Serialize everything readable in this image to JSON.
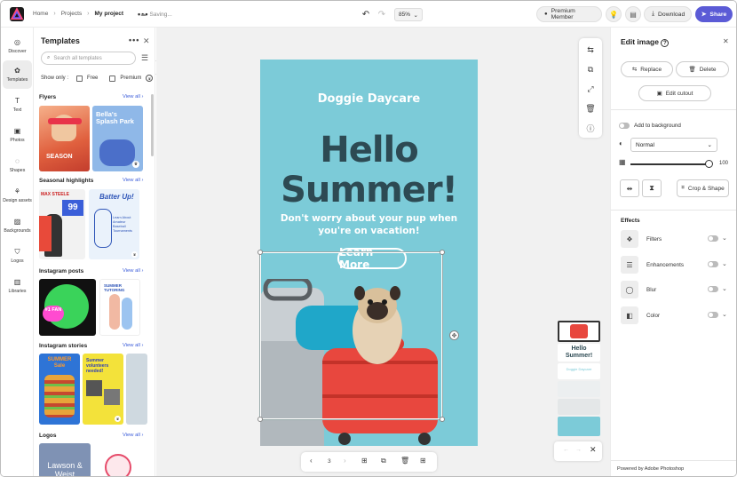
{
  "header": {
    "breadcrumbs": [
      "Home",
      "Projects",
      "My project"
    ],
    "status": "Saving...",
    "zoom": "85%",
    "premium_label": "Premium Member",
    "download_label": "Download",
    "share_label": "Share"
  },
  "rail": {
    "items": [
      {
        "label": "Discover",
        "icon": "compass-icon"
      },
      {
        "label": "Templates",
        "icon": "templates-icon"
      },
      {
        "label": "Text",
        "icon": "text-icon"
      },
      {
        "label": "Photos",
        "icon": "photo-icon"
      },
      {
        "label": "Shapes",
        "icon": "shapes-icon"
      },
      {
        "label": "Design assets",
        "icon": "design-assets-icon"
      },
      {
        "label": "Backgrounds",
        "icon": "backgrounds-icon"
      },
      {
        "label": "Logos",
        "icon": "logo-icon"
      },
      {
        "label": "Libraries",
        "icon": "library-icon"
      }
    ]
  },
  "templates": {
    "title": "Templates",
    "search_placeholder": "Search all templates",
    "show_only": "Show only :",
    "filters": [
      "Free",
      "Premium"
    ],
    "view_all": "View all",
    "sections": [
      "Flyers",
      "Seasonal highlights",
      "Instagram posts",
      "Instagram stories",
      "Logos"
    ],
    "thumb_texts": {
      "flyer1": "SEASON",
      "flyer2": "Bella's Splash Park",
      "seasonal1_name": "MAX STEELE",
      "seasonal1_num": "99",
      "seasonal2": "Batter Up!",
      "seasonal2_sub": "Learn About Amateur Baseball Tournaments",
      "insta1": "#1 FAN",
      "insta2": "SUMMER TUTORING",
      "story1": "SUMMER Sale",
      "story2": "Summer volunteers needed!",
      "logo1": "Lawson & Weist"
    }
  },
  "design": {
    "brand": "Doggie Daycare",
    "headline": "Hello Summer!",
    "tagline": "Don't worry about your pup when you're on vacation!",
    "cta": "Learn More"
  },
  "pagebar": {
    "page": "3"
  },
  "pages_panel": {
    "thumb_hello": "Hello Summer!",
    "thumb_brand": "Doggie Daycare"
  },
  "edit_image": {
    "title": "Edit image",
    "replace": "Replace",
    "delete": "Delete",
    "edit_cutout": "Edit cutout",
    "add_to_background": "Add to background",
    "blend_mode": "Normal",
    "opacity": "100",
    "opacity_fraction": 1.0,
    "crop_shape": "Crop & Shape",
    "effects_title": "Effects",
    "effects": [
      "Filters",
      "Enhancements",
      "Blur",
      "Color"
    ],
    "powered_by": "Powered by Adobe Photoshop"
  }
}
